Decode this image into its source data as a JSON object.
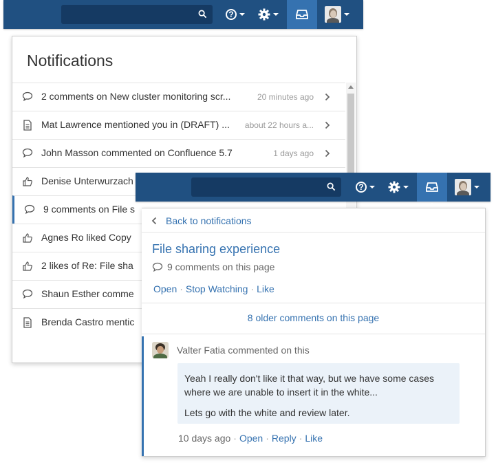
{
  "panel1": {
    "title": "Notifications",
    "items": [
      {
        "icon": "comment-icon",
        "text": "2 comments on New cluster monitoring scr...",
        "time": "20 minutes ago"
      },
      {
        "icon": "page-icon",
        "text": "Mat Lawrence mentioned you in (DRAFT) ...",
        "time": "about 22 hours a..."
      },
      {
        "icon": "comment-icon",
        "text": "John Masson commented on Confluence 5.7",
        "time": "1 days ago"
      },
      {
        "icon": "like-icon",
        "text": "Denise Unterwurzach",
        "time": ""
      },
      {
        "icon": "comment-icon",
        "text": "9 comments on File s",
        "time": ""
      },
      {
        "icon": "like-icon",
        "text": "Agnes Ro liked Copy",
        "time": ""
      },
      {
        "icon": "like-icon",
        "text": "2 likes of Re: File sha",
        "time": ""
      },
      {
        "icon": "comment-icon",
        "text": "Shaun Esther comme",
        "time": ""
      },
      {
        "icon": "page-icon",
        "text": "Brenda Castro mentic",
        "time": ""
      }
    ]
  },
  "panel2": {
    "back_label": "Back to notifications",
    "page_title": "File sharing experience",
    "comments_count": "9 comments on this page",
    "actions": {
      "open": "Open",
      "stop_watching": "Stop Watching",
      "like": "Like"
    },
    "older_comments": "8 older comments on this page",
    "comment": {
      "author_line": "Valter Fatia commented on this",
      "paragraphs": [
        "Yeah I really don't like it that way, but we have some cases where we are unable to insert it in the white...",
        "Lets go with the white and review later."
      ],
      "time": "10 days ago",
      "open": "Open",
      "reply": "Reply",
      "like": "Like"
    }
  },
  "colors": {
    "header": "#205081",
    "active_tab": "#3572b0",
    "link": "#3572b0",
    "comment_bg": "#ebf2f9"
  }
}
